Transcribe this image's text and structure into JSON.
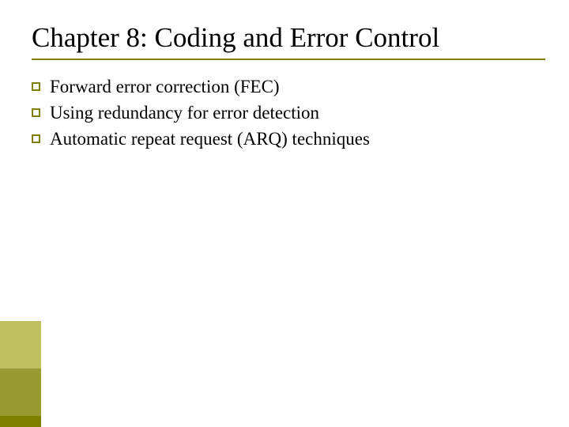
{
  "title": "Chapter 8: Coding and Error Control",
  "bullets": [
    "Forward error correction (FEC)",
    "Using redundancy for error detection",
    "Automatic repeat request (ARQ) techniques"
  ]
}
